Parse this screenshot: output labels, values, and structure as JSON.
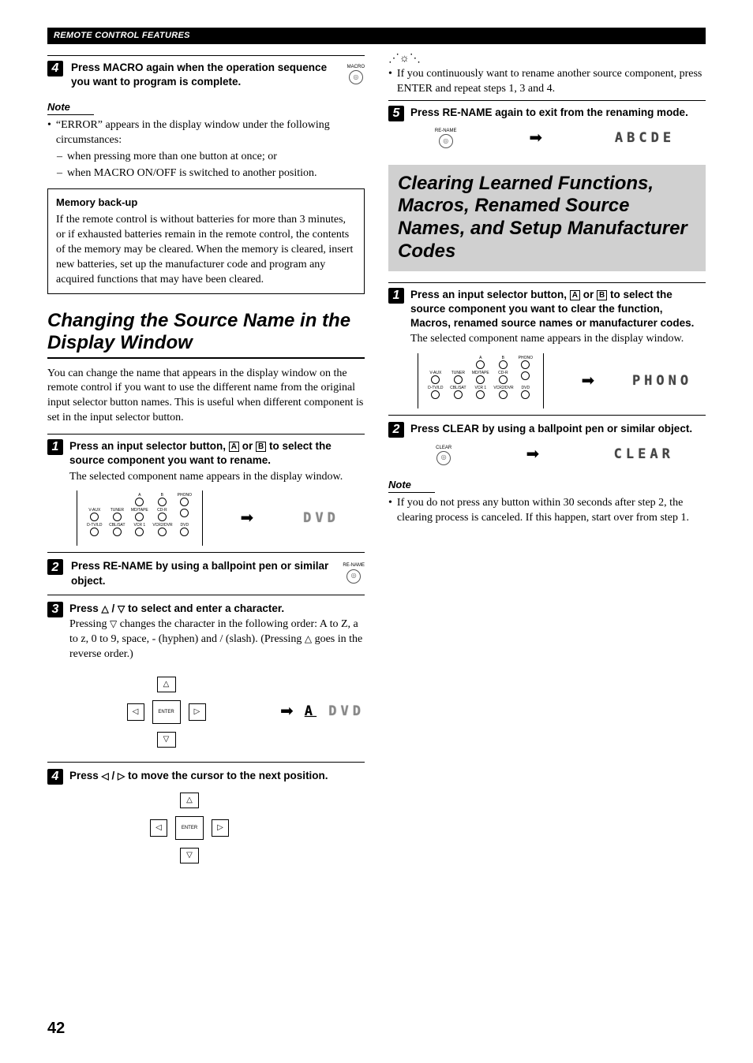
{
  "header": "REMOTE CONTROL FEATURES",
  "page_number": "42",
  "left": {
    "step4a": {
      "num": "4",
      "title": "Press MACRO again when the operation sequence you want to program is complete.",
      "btn_label": "MACRO"
    },
    "note_label": "Note",
    "note_bullet": "“ERROR” appears in the display window under the following circumstances:",
    "note_dash1": "when pressing more than one button at once; or",
    "note_dash2": "when MACRO ON/OFF is switched to another position.",
    "memory": {
      "title": "Memory back-up",
      "body": "If the remote control is without batteries for more than 3 minutes, or if exhausted batteries remain in the remote control, the contents of the memory may be cleared. When the memory is cleared, insert new batteries, set up the manufacturer code and program any acquired functions that may have been cleared."
    },
    "section_rename": "Changing the Source Name in the Display Window",
    "rename_intro": "You can change the name that appears in the display window on the remote control if you want to use the different name from the original input selector button names. This is useful when different component is set in the input selector button.",
    "step1": {
      "num": "1",
      "title_a": "Press an input selector button, ",
      "title_b": " or ",
      "title_c": " to select the source component you want to rename.",
      "body": "The selected component name appears in the display window.",
      "display": " DVD "
    },
    "step2": {
      "num": "2",
      "title": "Press RE-NAME by using a ballpoint pen or similar object.",
      "btn_label": "RE-NAME"
    },
    "step3": {
      "num": "3",
      "title_a": "Press ",
      "title_b": " / ",
      "title_c": " to select and enter a character.",
      "body_a": "Pressing ",
      "body_b": " changes the character in the following order: A to Z, a to z, 0 to 9, space, - (hyphen) and / (slash). (Pressing ",
      "body_c": " goes in the reverse order.)",
      "display": "A DVD",
      "enter": "ENTER"
    },
    "step4b": {
      "num": "4",
      "title_a": "Press ",
      "title_b": " / ",
      "title_c": " to move the cursor to the next position.",
      "enter": "ENTER"
    },
    "remote_labels": {
      "r1": [
        "V-AUX",
        "TUNER",
        "MD/TAPE",
        "CD-R",
        "PHONO"
      ],
      "r2": [
        "D-TV/LD",
        "CBL/SAT",
        "VCR 1",
        "VCR2/DVR",
        "DVD"
      ],
      "ab": [
        "A",
        "B"
      ]
    }
  },
  "right": {
    "hint_bullet": "If you continuously want to rename another source component, press ENTER and repeat steps 1, 3 and 4.",
    "step5": {
      "num": "5",
      "title": "Press RE-NAME again to exit from the renaming mode.",
      "btn_label": "RE-NAME",
      "display": "ABCDE"
    },
    "section_clear": "Clearing Learned Functions, Macros, Renamed Source Names, and Setup Manufacturer Codes",
    "step1": {
      "num": "1",
      "title_a": "Press an input selector button, ",
      "title_b": " or ",
      "title_c": " to select the source component you want to clear the function, Macros, renamed source names or manufacturer codes.",
      "body": "The selected component name appears in the display window.",
      "display": "PHONO"
    },
    "step2": {
      "num": "2",
      "title": "Press CLEAR by using a ballpoint pen or similar object.",
      "btn_label": "CLEAR",
      "display": "CLEAR"
    },
    "note_label": "Note",
    "note_bullet": "If you do not press any button within 30 seconds after step 2, the clearing process is canceled. If this happen, start over from step 1."
  }
}
